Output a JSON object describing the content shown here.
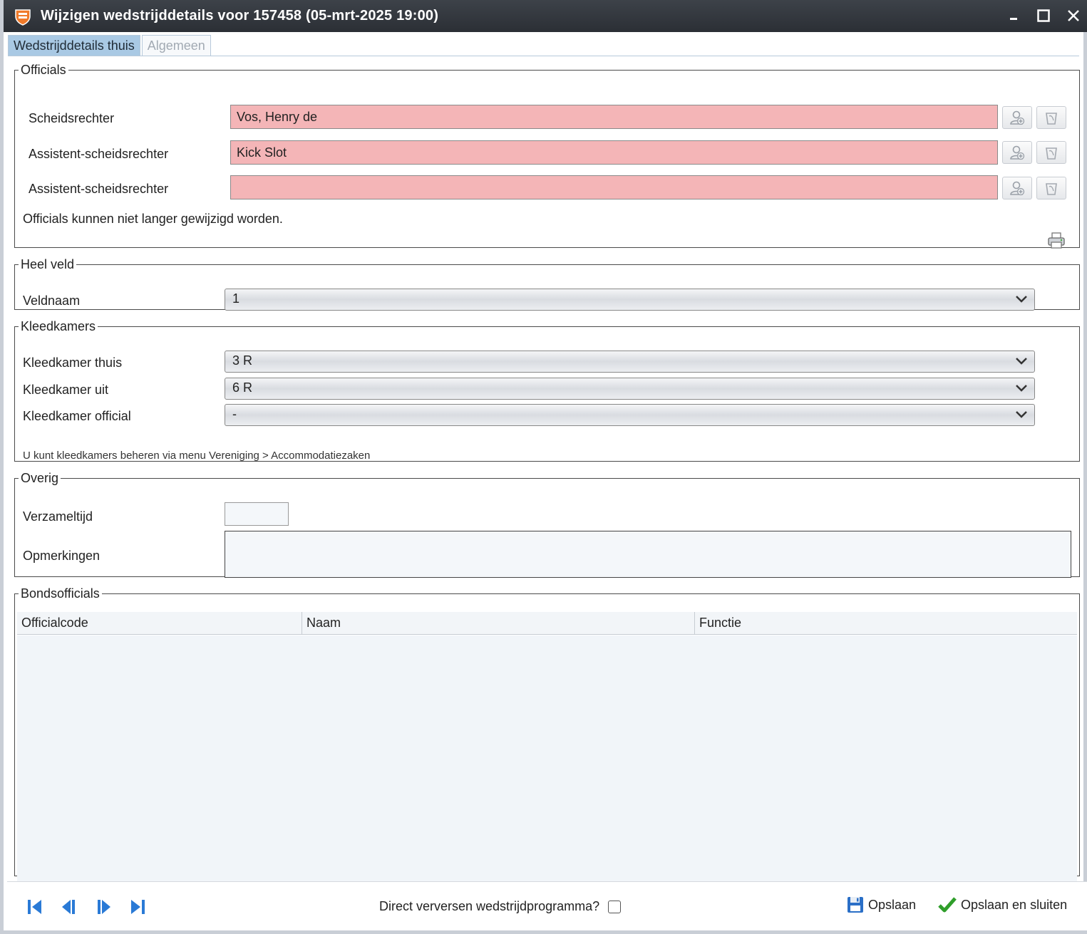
{
  "window": {
    "title": "Wijzigen wedstrijddetails voor 157458 (05-mrt-2025 19:00)",
    "logo_icon": "shield-logo",
    "controls": [
      "minimize-icon",
      "maximize-icon",
      "close-icon"
    ]
  },
  "tabs": [
    {
      "label": "Wedstrijddetails thuis",
      "active": true
    },
    {
      "label": "Algemeen",
      "active": false
    }
  ],
  "officials": {
    "legend": "Officials",
    "rows": [
      {
        "label": "Scheidsrechter",
        "value": "Vos, Henry de"
      },
      {
        "label": "Assistent-scheidsrechter",
        "value": "Kick Slot"
      },
      {
        "label": "Assistent-scheidsrechter",
        "value": ""
      }
    ],
    "note": "Officials kunnen niet langer gewijzigd worden.",
    "field_color": "#f4b5b7"
  },
  "heel_veld": {
    "legend": "Heel veld",
    "veldnaam_label": "Veldnaam",
    "veldnaam_value": "1"
  },
  "kleedkamers": {
    "legend": "Kleedkamers",
    "thuis_label": "Kleedkamer thuis",
    "thuis_value": "3 R",
    "uit_label": "Kleedkamer uit",
    "uit_value": "6 R",
    "official_label": "Kleedkamer official",
    "official_value": "-",
    "note": "U kunt kleedkamers beheren via menu Vereniging > Accommodatiezaken"
  },
  "overig": {
    "legend": "Overig",
    "verzameltijd_label": "Verzameltijd",
    "verzameltijd_value": "",
    "opmerkingen_label": "Opmerkingen",
    "opmerkingen_value": ""
  },
  "bondsofficials": {
    "legend": "Bondsofficials",
    "columns": [
      "Officialcode",
      "Naam",
      "Functie"
    ],
    "rows": []
  },
  "footer": {
    "refresh_label": "Direct verversen wedstrijdprogramma?",
    "refresh_checked": false,
    "save_label": "Opslaan",
    "save_close_label": "Opslaan en sluiten"
  }
}
